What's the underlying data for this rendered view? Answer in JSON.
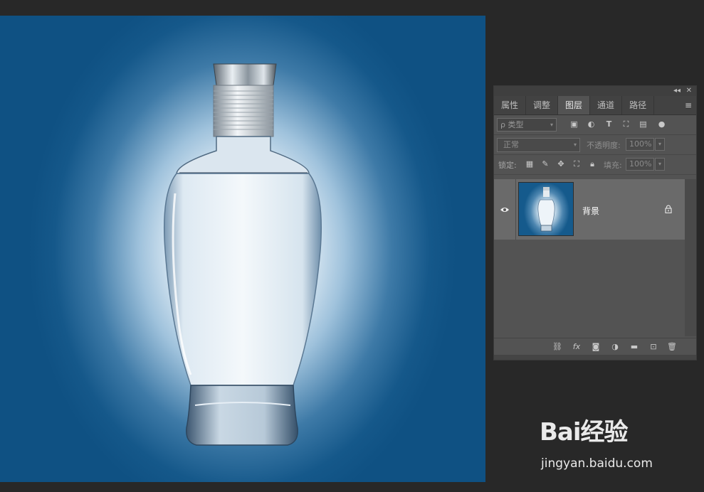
{
  "panel": {
    "tabs": [
      {
        "label": "属性",
        "active": false
      },
      {
        "label": "调整",
        "active": false
      },
      {
        "label": "图层",
        "active": true
      },
      {
        "label": "通道",
        "active": false
      },
      {
        "label": "路径",
        "active": false
      }
    ],
    "filter": {
      "label": "ρ 类型",
      "icons": [
        "image-filter-icon",
        "adjustment-filter-icon",
        "type-filter-icon",
        "shape-filter-icon",
        "smart-object-filter-icon",
        "filter-toggle-icon"
      ]
    },
    "blend_mode": "正常",
    "opacity_label": "不透明度:",
    "opacity_value": "100%",
    "lock_label": "锁定:",
    "fill_label": "填充:",
    "fill_value": "100%",
    "layers": [
      {
        "name": "背景",
        "visible": true,
        "locked": true
      }
    ],
    "bottom_icons": [
      "link-layers-icon",
      "fx-icon",
      "add-mask-icon",
      "adjustment-layer-icon",
      "new-group-icon",
      "new-layer-icon",
      "delete-layer-icon"
    ]
  },
  "watermark": {
    "logo_text": "Bai经验",
    "url": "jingyan.baidu.com"
  },
  "colors": {
    "canvas_blue": "#0f5183",
    "panel_bg": "#535353",
    "app_bg": "#282828"
  }
}
